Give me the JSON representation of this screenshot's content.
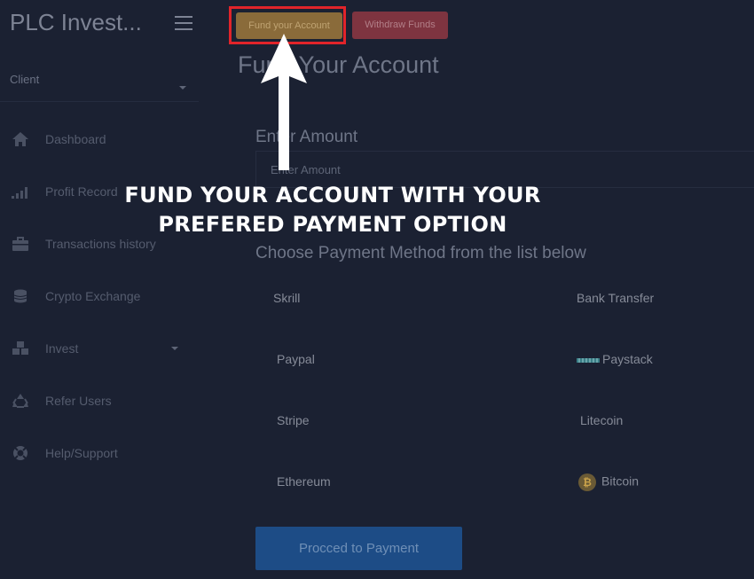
{
  "app": {
    "brand": "PLC Invest..."
  },
  "sidebar": {
    "user_role": "Client",
    "items": [
      {
        "label": "Dashboard",
        "icon": "home-icon"
      },
      {
        "label": "Profit Record",
        "icon": "signal-icon"
      },
      {
        "label": "Transactions history",
        "icon": "briefcase-icon"
      },
      {
        "label": "Crypto Exchange",
        "icon": "coins-icon"
      },
      {
        "label": "Invest",
        "icon": "cubes-icon"
      },
      {
        "label": "Refer Users",
        "icon": "recycle-icon"
      },
      {
        "label": "Help/Support",
        "icon": "lifebuoy-icon"
      }
    ]
  },
  "toolbar": {
    "fund_label": "Fund your Account",
    "withdraw_label": "Withdraw Funds"
  },
  "main": {
    "title": "Fund Your Account",
    "amount_label": "Enter Amount",
    "amount_placeholder": "Enter Amount",
    "choose_label": "Choose Payment Method from the list below",
    "methods": {
      "skrill": "Skrill",
      "bank_transfer": "Bank Transfer",
      "paypal": "Paypal",
      "paystack": "Paystack",
      "stripe": "Stripe",
      "litecoin": "Litecoin",
      "ethereum": "Ethereum",
      "bitcoin": "Bitcoin"
    },
    "proceed_label": "Procced to Payment"
  },
  "annotation": {
    "line1": "FUND YOUR ACCOUNT WITH YOUR",
    "line2": "PREFERED PAYMENT OPTION"
  },
  "colors": {
    "background": "#1b2132",
    "fund_button": "#8a6b3a",
    "withdraw_button": "#7e3440",
    "proceed_button": "#1d4c86",
    "highlight_box": "#e1242a"
  }
}
